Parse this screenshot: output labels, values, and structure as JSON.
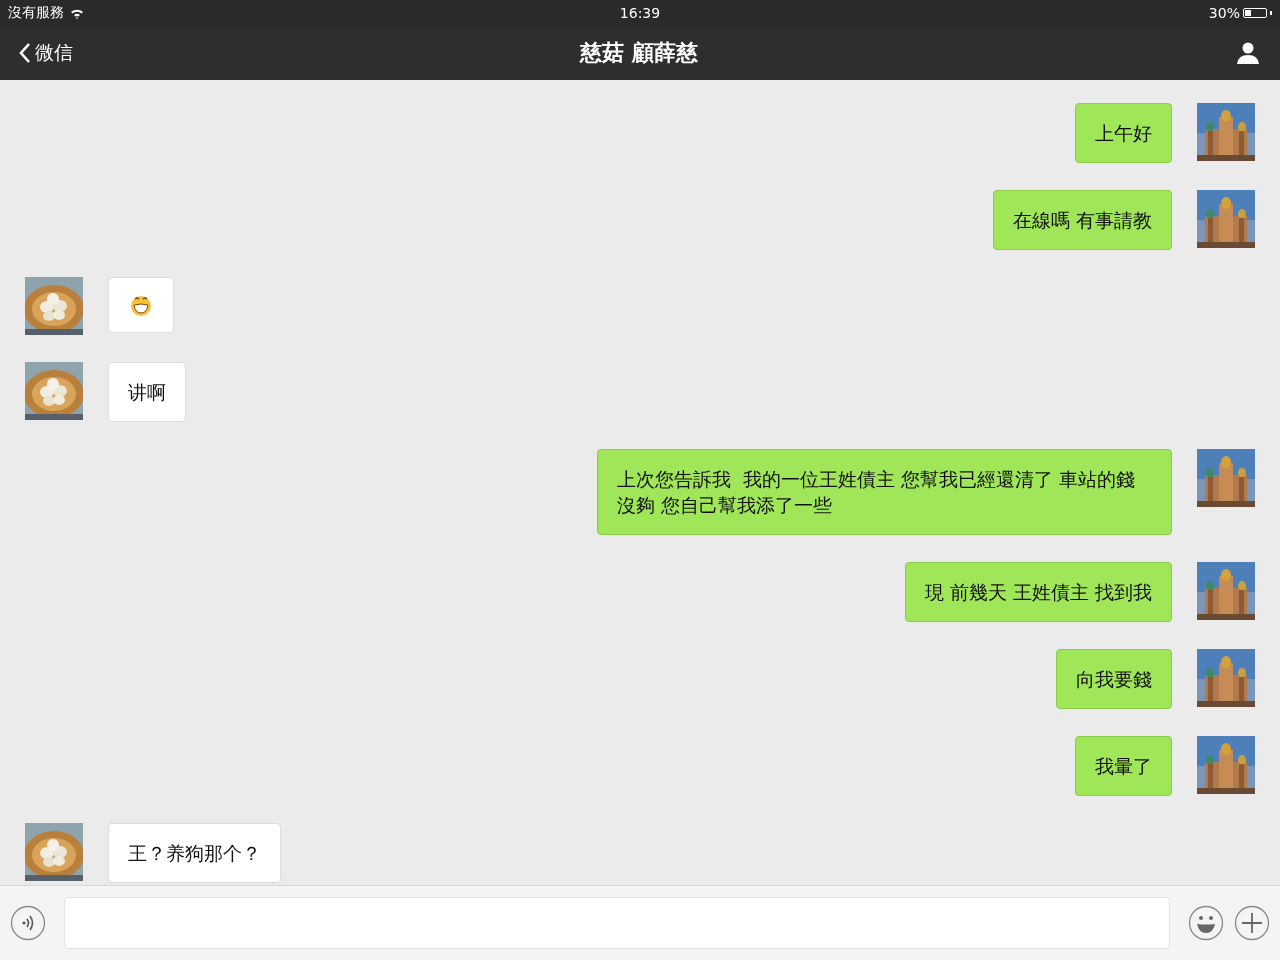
{
  "status_bar": {
    "carrier": "沒有服務",
    "time": "16:39",
    "battery": "30%"
  },
  "nav_bar": {
    "back_label": "微信",
    "title": "慈菇 顧薛慈"
  },
  "messages": [
    {
      "kind": "sent",
      "text": "上午好"
    },
    {
      "kind": "sent",
      "text": "在線嗎 有事請教"
    },
    {
      "kind": "received_emoji"
    },
    {
      "kind": "received",
      "text": "讲啊"
    },
    {
      "kind": "sent",
      "text": "上次您告訴我  我的一位王姓債主 您幫我已經還清了 車站的錢沒夠 您自己幫我添了一些"
    },
    {
      "kind": "sent",
      "text": "現 前幾天 王姓債主 找到我"
    },
    {
      "kind": "sent",
      "text": "向我要錢"
    },
    {
      "kind": "sent",
      "text": "我暈了"
    },
    {
      "kind": "received",
      "text": "王？养狗那个？"
    }
  ]
}
